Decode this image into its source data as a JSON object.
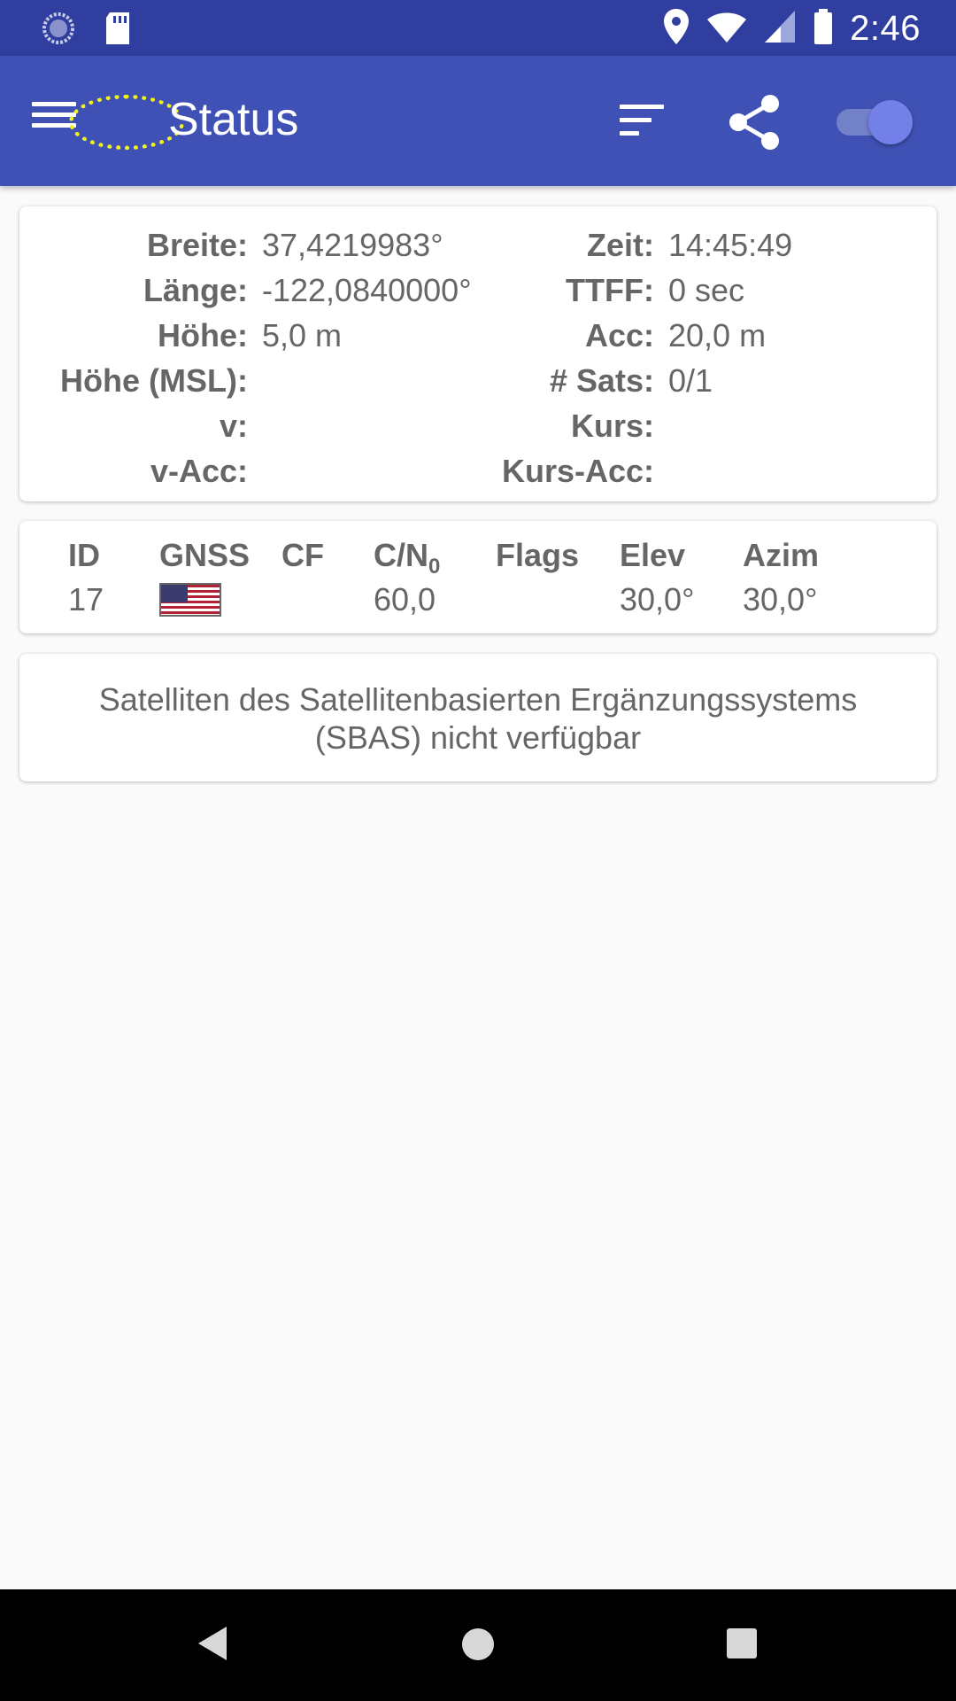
{
  "status_bar": {
    "time": "2:46",
    "icons": [
      "sync-icon",
      "sd-card-icon",
      "location-icon",
      "wifi-icon",
      "signal-icon",
      "battery-icon"
    ]
  },
  "app_bar": {
    "title": "Status",
    "icons": [
      "menu-icon",
      "sort-icon",
      "share-icon"
    ],
    "toggle_on": true,
    "accent": "#3f51b5",
    "status_bar_color": "#303f9f"
  },
  "location": {
    "left": [
      {
        "label": "Breite:",
        "value": "37,4219983°"
      },
      {
        "label": "Länge:",
        "value": "-122,0840000°"
      },
      {
        "label": "Höhe:",
        "value": "5,0 m"
      },
      {
        "label": "Höhe (MSL):",
        "value": ""
      },
      {
        "label": "v:",
        "value": ""
      },
      {
        "label": "v-Acc:",
        "value": ""
      }
    ],
    "right": [
      {
        "label": "Zeit:",
        "value": "14:45:49"
      },
      {
        "label": "TTFF:",
        "value": "0 sec"
      },
      {
        "label": "Acc:",
        "value": "20,0 m"
      },
      {
        "label": "# Sats:",
        "value": "0/1"
      },
      {
        "label": "Kurs:",
        "value": ""
      },
      {
        "label": "Kurs-Acc:",
        "value": ""
      }
    ]
  },
  "satellites": {
    "headers": {
      "id": "ID",
      "gnss": "GNSS",
      "cf": "CF",
      "cn0_main": "C/N",
      "cn0_sub": "0",
      "flags": "Flags",
      "elev": "Elev",
      "azim": "Azim"
    },
    "rows": [
      {
        "id": "17",
        "gnss_flag": "us-flag-icon",
        "cf": "",
        "cn0": "60,0",
        "flags": "",
        "elev": "30,0°",
        "azim": "30,0°"
      }
    ]
  },
  "sbas": {
    "message": "Satelliten des Satellitenbasierten Ergänzungssystems (SBAS) nicht verfügbar"
  },
  "nav_bar": {
    "icons": [
      "back-icon",
      "home-icon",
      "recents-icon"
    ]
  }
}
